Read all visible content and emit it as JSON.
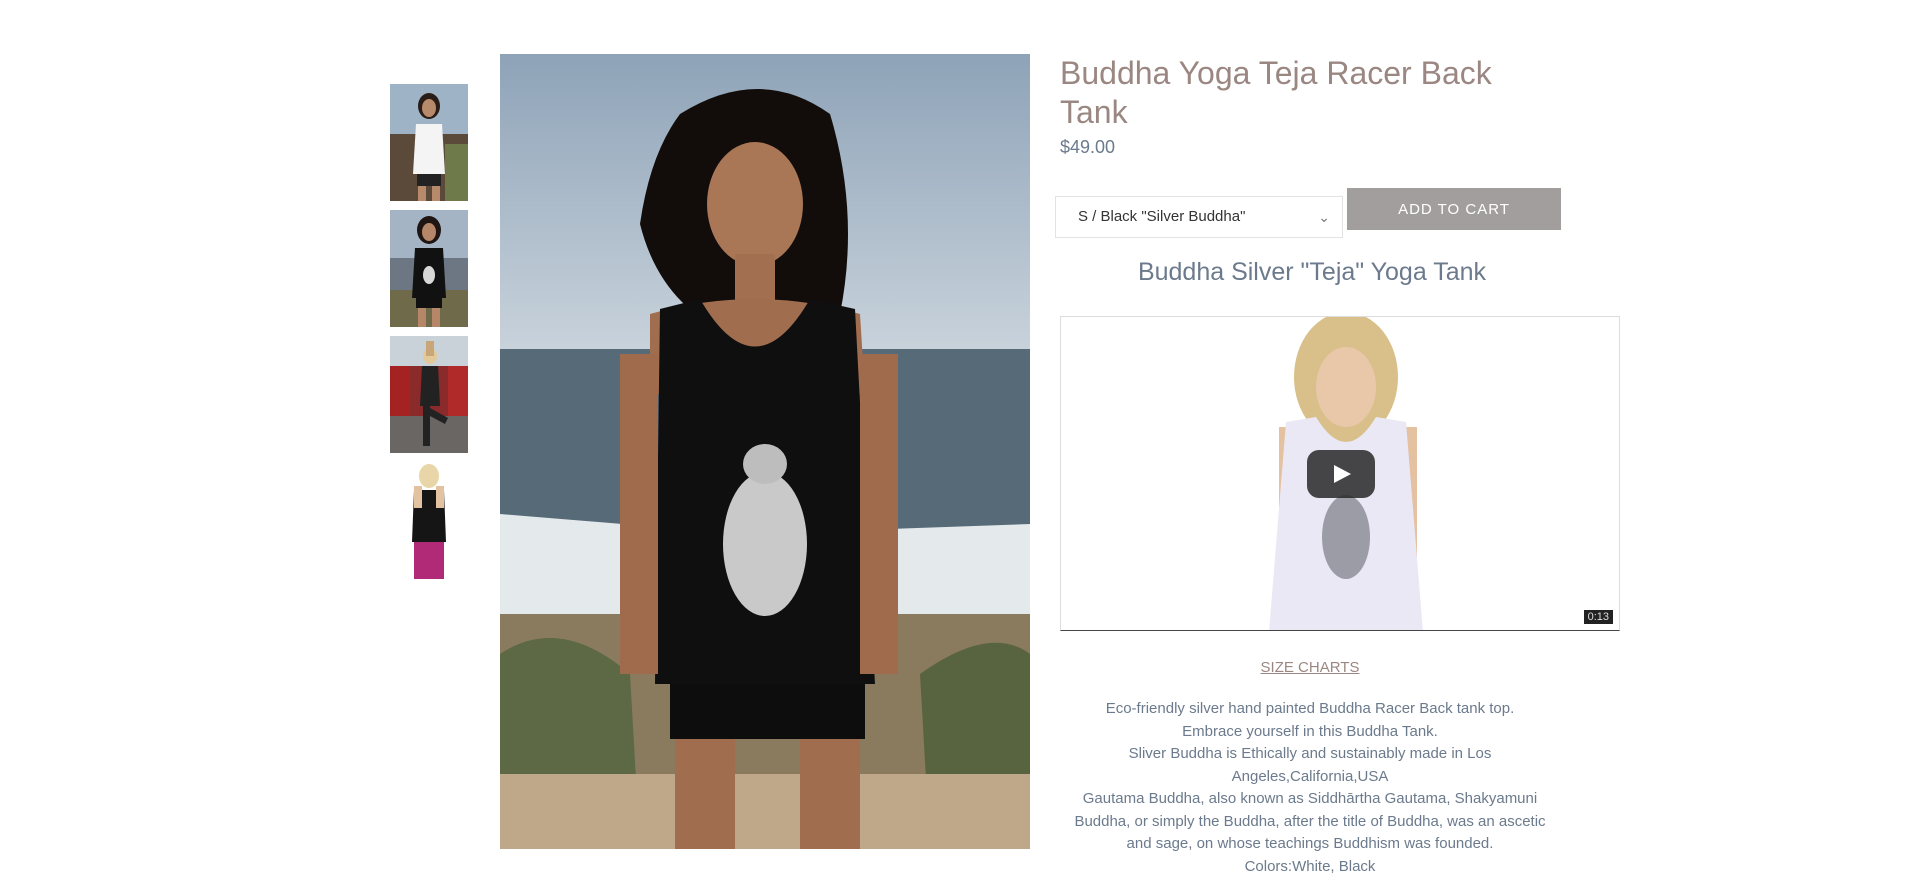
{
  "product": {
    "title": "Buddha Yoga Teja Racer Back Tank",
    "price": "$49.00",
    "variant_selected": "S / Black \"Silver Buddha\"",
    "add_to_cart_label": "ADD TO CART",
    "subtitle": "Buddha Silver \"Teja\" Yoga Tank",
    "size_charts_label": "SIZE CHARTS"
  },
  "video": {
    "duration": "0:13",
    "play_icon": "play-icon"
  },
  "description": [
    "Eco-friendly silver hand painted Buddha Racer Back tank top.",
    "Embrace yourself in this Buddha Tank.",
    "Sliver Buddha is Ethically and  sustainably made in Los Angeles,California,USA",
    "Gautama Buddha, also known as Siddhārtha Gautama, Shakyamuni Buddha, or simply the Buddha, after the title of Buddha, was an ascetic and sage, on whose teachings Buddhism was founded.",
    "Colors:White, Black"
  ],
  "gallery": {
    "thumbnails": [
      "white-tank-thumb",
      "black-tank-thumb",
      "yoga-pose-thumb",
      "back-view-thumb"
    ]
  },
  "colors": {
    "title": "#9b8782",
    "text": "#6b7a8c",
    "button": "#a39e9e"
  }
}
